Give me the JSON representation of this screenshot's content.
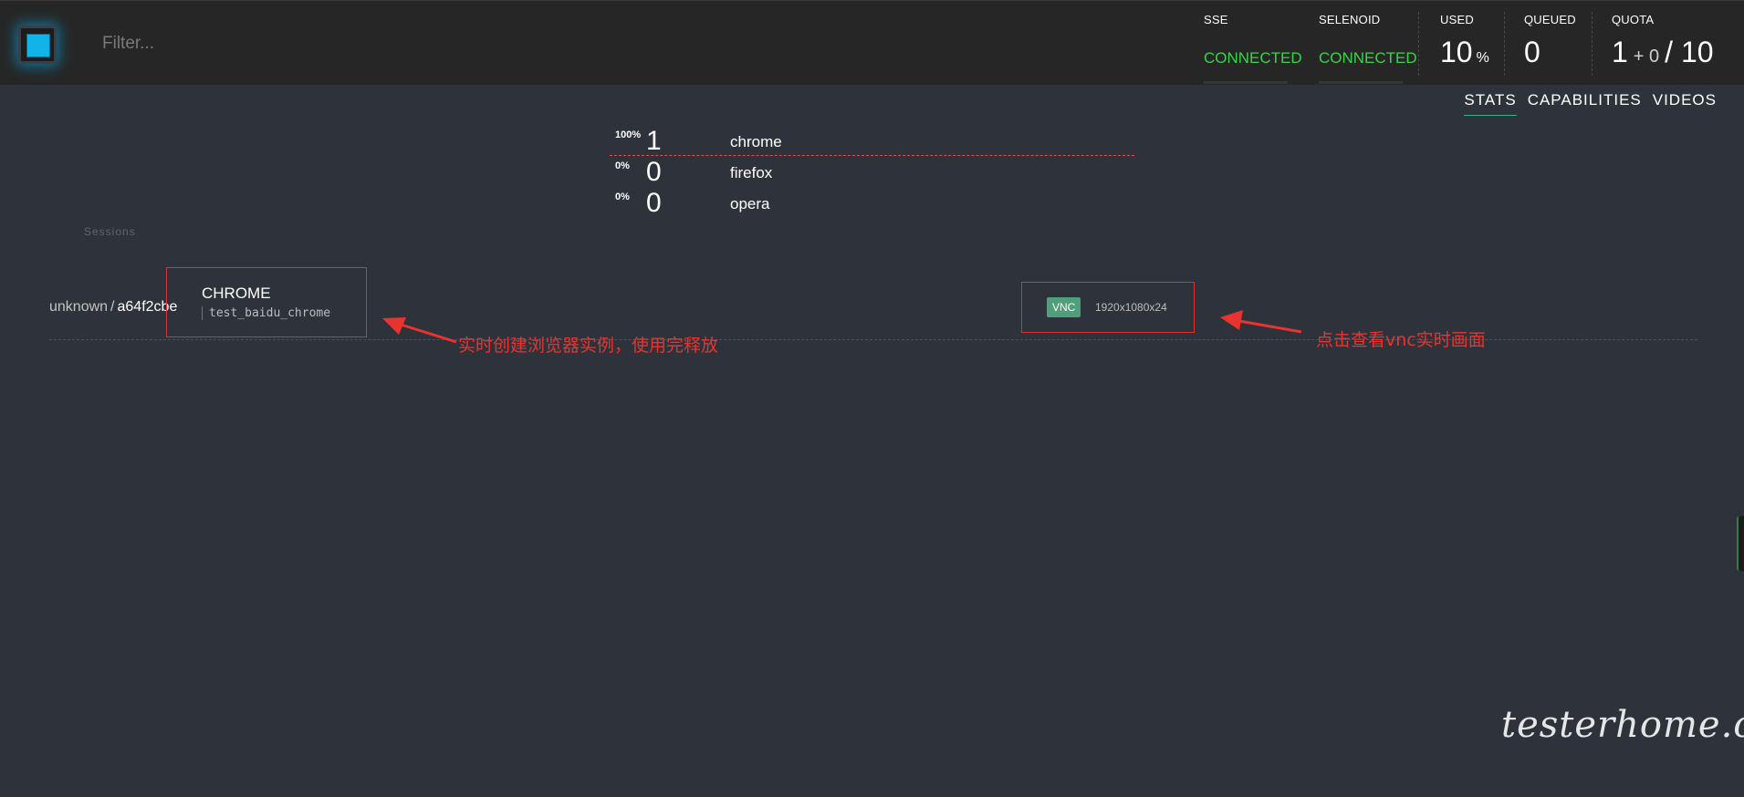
{
  "header": {
    "filter_placeholder": "Filter...",
    "sse_label": "SSE",
    "sse_status": "CONNECTED",
    "selenoid_label": "SELENOID",
    "selenoid_status": "CONNECTED",
    "used_label": "USED",
    "used_value": "10",
    "used_unit": "%",
    "queued_label": "QUEUED",
    "queued_value": "0",
    "quota_label": "QUOTA",
    "quota_value": "1",
    "quota_pending": "+ 0",
    "quota_total": "/ 10",
    "colors": {
      "connected": "#3ad24b",
      "logo": "#11b4e9"
    }
  },
  "tabs": [
    {
      "label": "STATS",
      "active": true
    },
    {
      "label": "CAPABILITIES",
      "active": false
    },
    {
      "label": "VIDEOS",
      "active": false
    }
  ],
  "browsers": [
    {
      "percent": "100%",
      "count": "1",
      "name": "chrome"
    },
    {
      "percent": "0%",
      "count": "0",
      "name": "firefox"
    },
    {
      "percent": "0%",
      "count": "0",
      "name": "opera"
    }
  ],
  "sessions": {
    "label": "Sessions",
    "items": [
      {
        "user": "unknown",
        "separator": "/",
        "id": "a64f2cbe",
        "capability": "CHROME",
        "test_name": "test_baidu_chrome",
        "vnc_label": "VNC",
        "resolution": "1920x1080x24"
      }
    ]
  },
  "annotations": {
    "left": "实时创建浏览器实例，使用完释放",
    "right": "点击查看vnc实时画面",
    "color": "#e8332f"
  },
  "watermark": "testerhome.com"
}
